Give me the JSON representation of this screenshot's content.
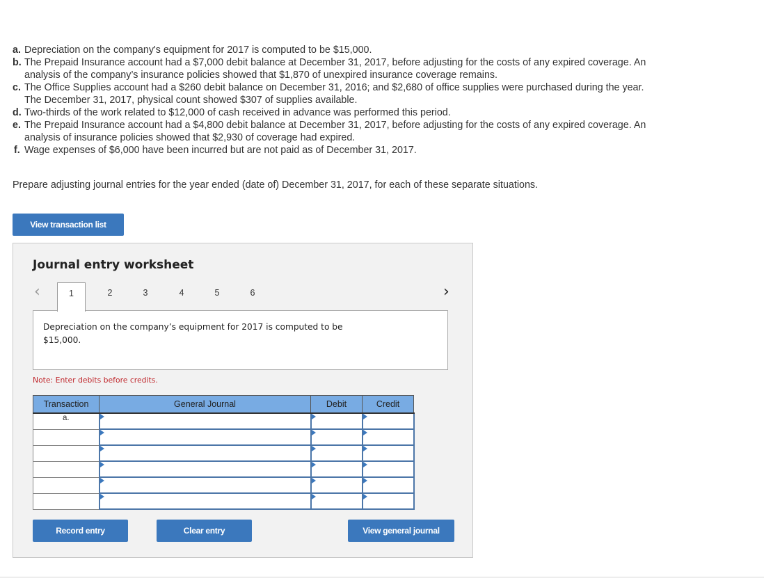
{
  "problem": {
    "items": [
      {
        "label": "a.",
        "text": "Depreciation on the company's equipment for 2017 is computed to be $15,000."
      },
      {
        "label": "b.",
        "text": "The Prepaid Insurance account had a $7,000 debit balance at December 31, 2017, before adjusting for the costs of any expired coverage. An analysis of the company’s insurance policies showed that $1,870 of unexpired insurance coverage remains."
      },
      {
        "label": "c.",
        "text": "The Office Supplies account had a $260 debit balance on December 31, 2016; and $2,680 of office supplies were purchased during the year. The December 31, 2017, physical count showed $307 of supplies available."
      },
      {
        "label": "d.",
        "text": "Two-thirds of the work related to $12,000 of cash received in advance was performed this period."
      },
      {
        "label": "e.",
        "text": "The Prepaid Insurance account had a $4,800 debit balance at December 31, 2017, before adjusting for the costs of any expired coverage. An analysis of insurance policies showed that $2,930 of coverage had expired."
      },
      {
        "label": "f.",
        "text": "Wage expenses of $6,000 have been incurred but are not paid as of December 31, 2017."
      }
    ],
    "instruction": "Prepare adjusting journal entries for the year ended (date of) December 31, 2017, for each of these separate situations."
  },
  "buttons": {
    "view_transaction_list": "View transaction list",
    "record_entry": "Record entry",
    "clear_entry": "Clear entry",
    "view_general_journal": "View general journal"
  },
  "worksheet": {
    "title": "Journal entry worksheet",
    "prev_icon": "chevron-left-icon",
    "next_icon": "chevron-right-icon",
    "tabs": [
      "1",
      "2",
      "3",
      "4",
      "5",
      "6"
    ],
    "active_tab": "1",
    "description": "Depreciation on the company’s equipment for 2017 is computed to be $15,000.",
    "note": "Note: Enter debits before credits.",
    "table": {
      "headers": [
        "Transaction",
        "General Journal",
        "Debit",
        "Credit"
      ],
      "rows": [
        {
          "transaction": "a.",
          "account": "",
          "debit": "",
          "credit": ""
        },
        {
          "transaction": "",
          "account": "",
          "debit": "",
          "credit": ""
        },
        {
          "transaction": "",
          "account": "",
          "debit": "",
          "credit": ""
        },
        {
          "transaction": "",
          "account": "",
          "debit": "",
          "credit": ""
        },
        {
          "transaction": "",
          "account": "",
          "debit": "",
          "credit": ""
        },
        {
          "transaction": "",
          "account": "",
          "debit": "",
          "credit": ""
        }
      ]
    }
  },
  "colors": {
    "button_blue": "#3b78bd",
    "table_header_blue": "#78abe3",
    "note_red": "#c0282d",
    "input_border_blue": "#4c76a8"
  }
}
